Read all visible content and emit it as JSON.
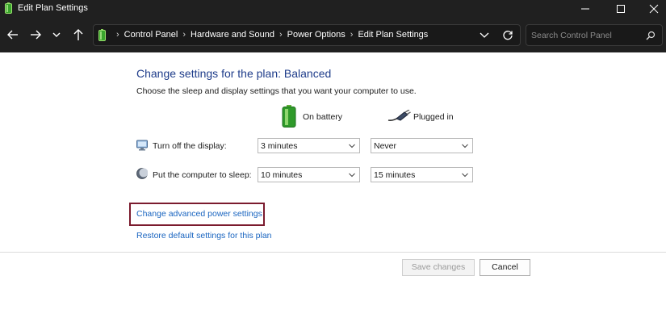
{
  "window": {
    "title": "Edit Plan Settings"
  },
  "address": {
    "crumbs": [
      "Control Panel",
      "Hardware and Sound",
      "Power Options",
      "Edit Plan Settings"
    ]
  },
  "search": {
    "placeholder": "Search Control Panel"
  },
  "main": {
    "heading": "Change settings for the plan: Balanced",
    "subtext": "Choose the sleep and display settings that you want your computer to use.",
    "columns": {
      "battery": "On battery",
      "plugged": "Plugged in"
    },
    "rows": [
      {
        "label": "Turn off the display:",
        "battery": "3 minutes",
        "plugged": "Never"
      },
      {
        "label": "Put the computer to sleep:",
        "battery": "10 minutes",
        "plugged": "15 minutes"
      }
    ],
    "links": {
      "advanced": "Change advanced power settings",
      "restore": "Restore default settings for this plan"
    }
  },
  "footer": {
    "save": "Save changes",
    "cancel": "Cancel"
  },
  "colors": {
    "accent_heading": "#1e3c8a",
    "link": "#1a65c0",
    "highlight_border": "#7b1b2e",
    "titlebar": "#202020"
  },
  "icons": {
    "app": "battery-icon",
    "address": "battery-icon",
    "battery_column": "battery-icon",
    "plugged_column": "power-plug-icon",
    "display_row": "monitor-icon",
    "sleep_row": "moon-icon"
  }
}
